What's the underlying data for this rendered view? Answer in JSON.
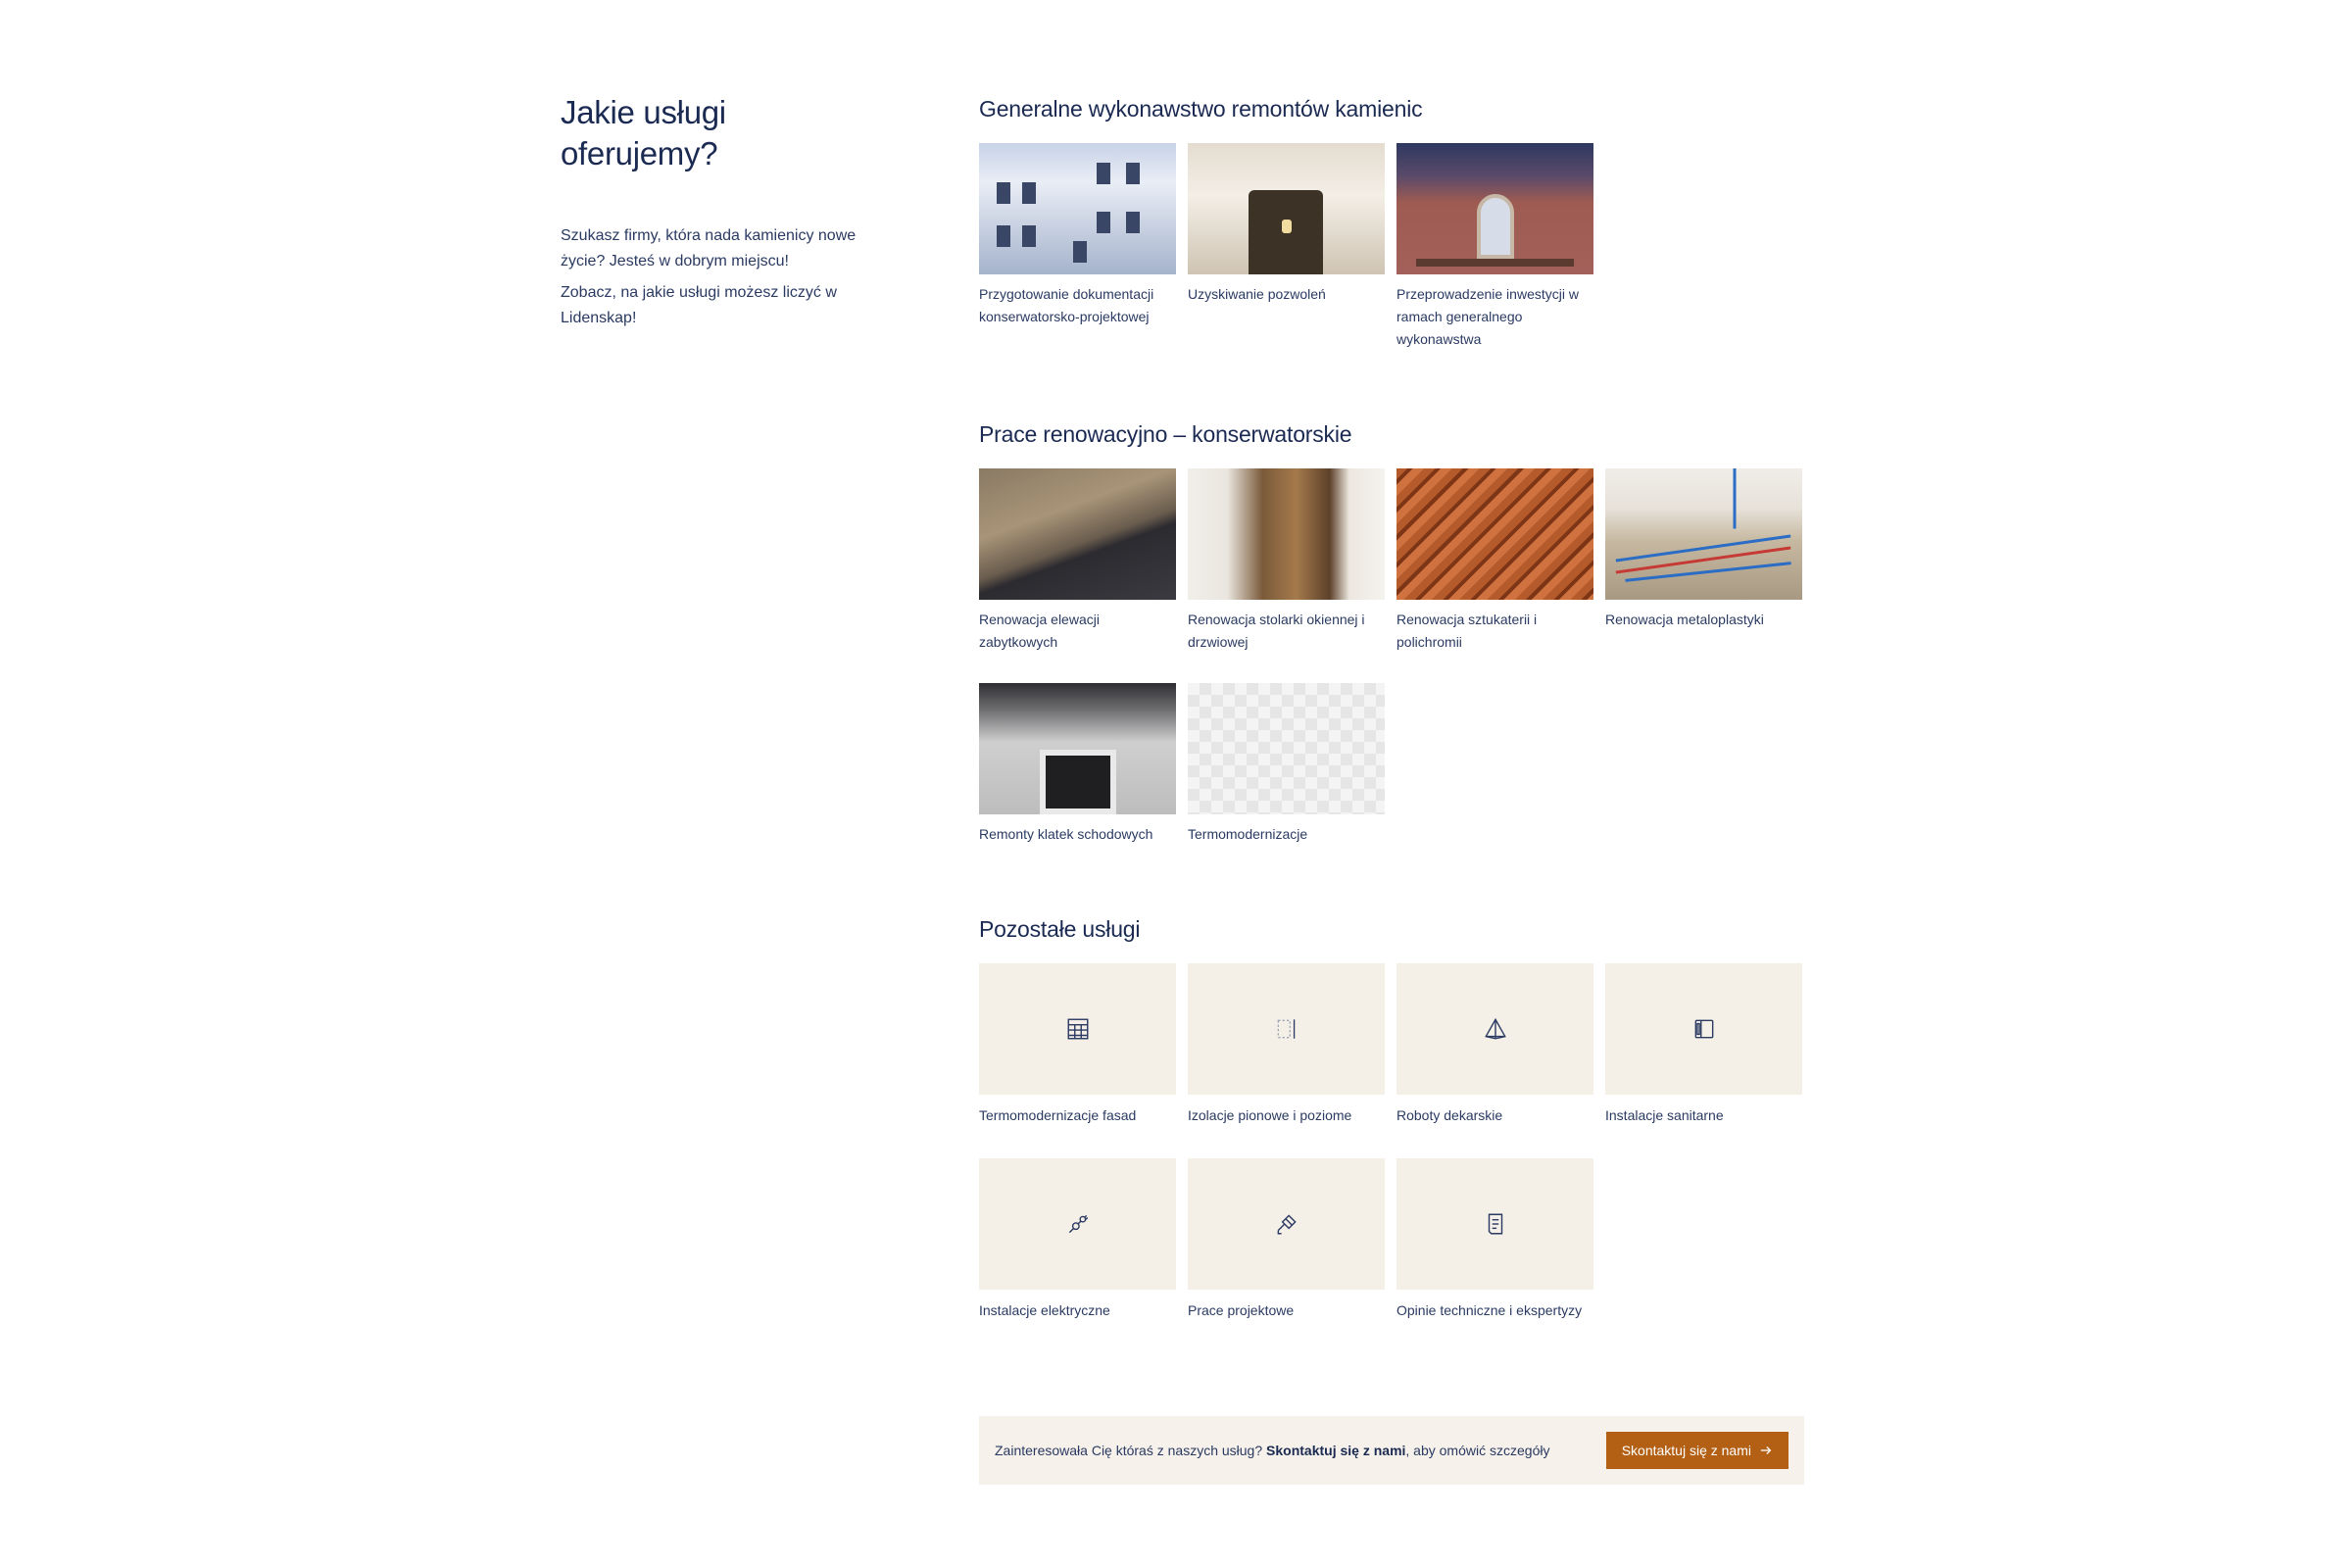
{
  "intro": {
    "heading": "Jakie usługi oferujemy?",
    "paragraph1": "Szukasz firmy, która nada kamienicy nowe życie? Jesteś w dobrym miejscu!",
    "paragraph2": "Zobacz, na jakie usługi możesz liczyć w Lidenskap!"
  },
  "general": {
    "title": "Generalne wykonawstwo remontów kamienic",
    "items": [
      {
        "label": "Przygotowanie dokumentacji konserwatorsko-projektowej"
      },
      {
        "label": "Uzyskiwanie pozwoleń"
      },
      {
        "label": "Przeprowadzenie inwestycji w ramach generalnego wykonawstwa"
      }
    ]
  },
  "renovation": {
    "title": "Prace renowacyjno – konserwatorskie",
    "items": [
      {
        "label": "Renowacja elewacji zabytkowych"
      },
      {
        "label": "Renowacja stolarki okiennej i drzwiowej"
      },
      {
        "label": "Renowacja sztukaterii i polichromii"
      },
      {
        "label": "Renowacja metaloplastyki"
      },
      {
        "label": "Remonty klatek schodowych"
      },
      {
        "label": "Termomodernizacje"
      }
    ]
  },
  "other": {
    "title": "Pozostałe usługi",
    "items": [
      {
        "label": "Termomodernizacje fasad",
        "icon": "facade-grid-icon"
      },
      {
        "label": "Izolacje pionowe i poziome",
        "icon": "insulation-icon"
      },
      {
        "label": "Roboty dekarskie",
        "icon": "roof-pyramid-icon"
      },
      {
        "label": "Instalacje sanitarne",
        "icon": "sanitary-icon"
      },
      {
        "label": "Instalacje elektryczne",
        "icon": "plug-icon"
      },
      {
        "label": "Prace projektowe",
        "icon": "drafting-icon"
      },
      {
        "label": "Opinie techniczne i ekspertyzy",
        "icon": "document-icon"
      }
    ]
  },
  "cta": {
    "text_before": "Zainteresowała Cię któraś z naszych usług?",
    "text_bold": "Skontaktuj się z nami",
    "text_after": ", aby omówić szczegóły",
    "button_label": "Skontaktuj się z nami"
  },
  "colors": {
    "text": "#1b2a52",
    "tile_background": "#f4efe7",
    "cta_background": "#f6f1ea",
    "button": "#b35f14"
  }
}
